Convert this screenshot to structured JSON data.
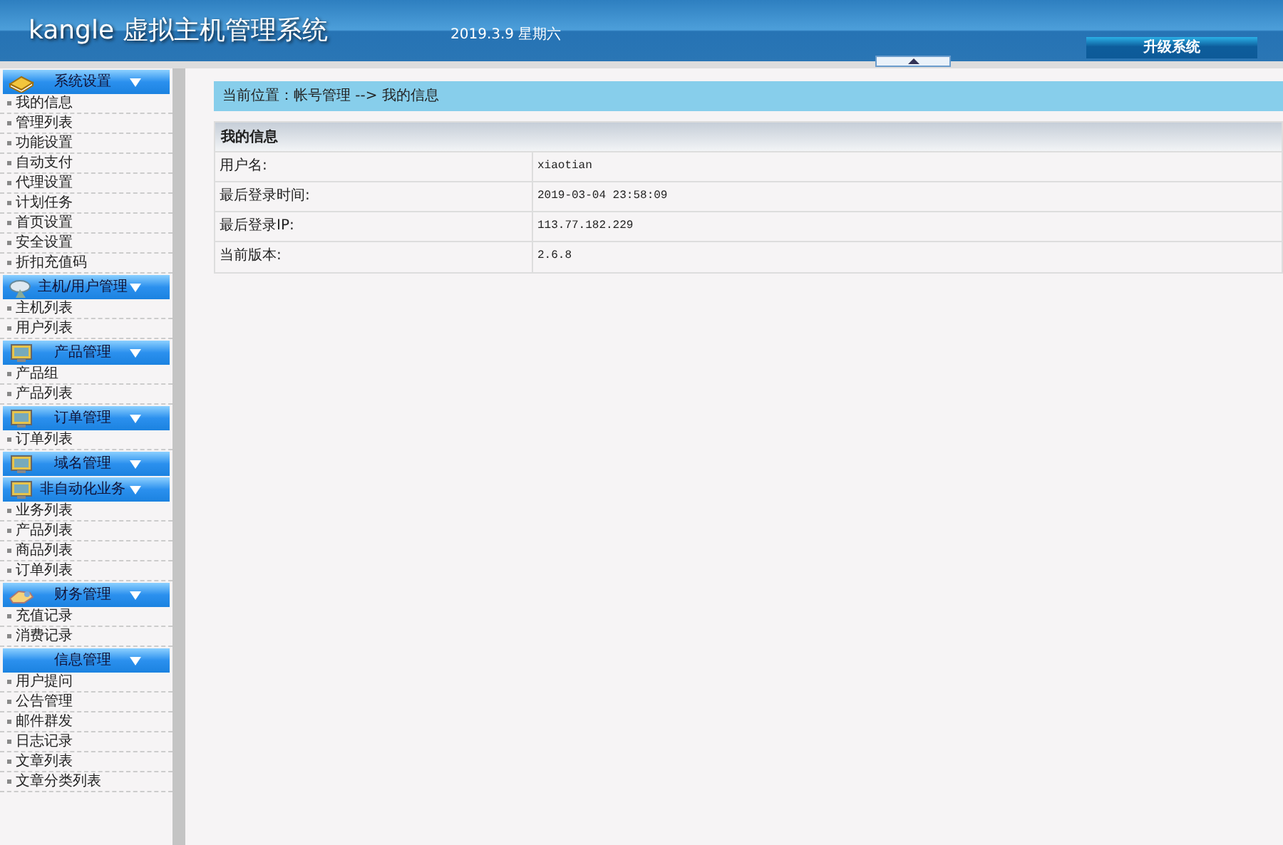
{
  "header": {
    "title": "kangle 虚拟主机管理系统",
    "date": "2019.3.9 星期六",
    "upgrade_button": "升级系统"
  },
  "sidebar": [
    {
      "title": "系统设置",
      "kind": "book",
      "items": [
        "我的信息",
        "管理列表",
        "功能设置",
        "自动支付",
        "代理设置",
        "计划任务",
        "首页设置",
        "安全设置",
        "折扣充值码"
      ]
    },
    {
      "title": "主机/用户管理",
      "kind": "dish",
      "items": [
        "主机列表",
        "用户列表"
      ]
    },
    {
      "title": "产品管理",
      "kind": "monitor",
      "items": [
        "产品组",
        "产品列表"
      ]
    },
    {
      "title": "订单管理",
      "kind": "monitor",
      "items": [
        "订单列表"
      ]
    },
    {
      "title": "域名管理",
      "kind": "monitor"
    },
    {
      "title": "非自动化业务",
      "kind": "monitor",
      "items": [
        "业务列表",
        "产品列表",
        "商品列表",
        "订单列表"
      ]
    },
    {
      "title": "财务管理",
      "kind": "hand",
      "items": [
        "充值记录",
        "消费记录"
      ]
    },
    {
      "title": "信息管理",
      "kind": "plain",
      "items": [
        "用户提问",
        "公告管理",
        "邮件群发",
        "日志记录",
        "文章列表",
        "文章分类列表"
      ]
    }
  ],
  "breadcrumb": "当前位置：帐号管理 --> 我的信息",
  "info_table": {
    "title": "我的信息",
    "rows": [
      {
        "label": "用户名:",
        "value": "xiaotian"
      },
      {
        "label": "最后登录时间:",
        "value": "2019-03-04 23:58:09"
      },
      {
        "label": "最后登录IP:",
        "value": "113.77.182.229"
      },
      {
        "label": "当前版本:",
        "value": "2.6.8"
      }
    ]
  }
}
